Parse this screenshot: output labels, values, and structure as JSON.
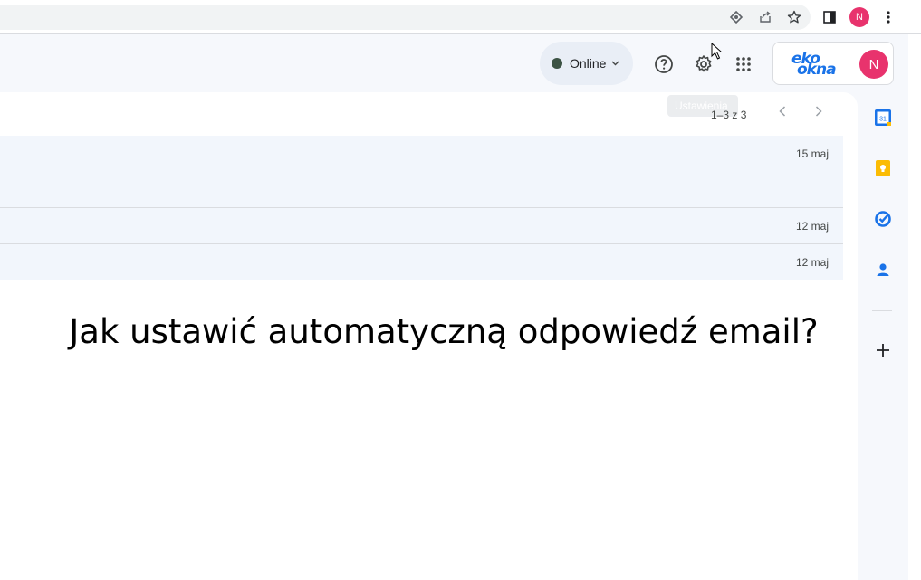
{
  "chrome": {
    "profile_initial": "N"
  },
  "header": {
    "status_label": "Online",
    "account_initial": "N",
    "logo_line1": "eko",
    "logo_line2": "okna",
    "settings_tooltip": "Ustawienia"
  },
  "mail_list": {
    "pagination": "1–3 z 3",
    "rows": [
      {
        "date": "15 maj"
      },
      {
        "date": "12 maj"
      },
      {
        "date": "12 maj"
      }
    ]
  },
  "caption": "Jak ustawić automatyczną odpowiedź email?",
  "side_panel": {
    "calendar_day": "31"
  },
  "colors": {
    "accent_blue": "#1a73e8",
    "avatar_pink": "#e8336d",
    "row_bg": "#f2f6fc"
  }
}
